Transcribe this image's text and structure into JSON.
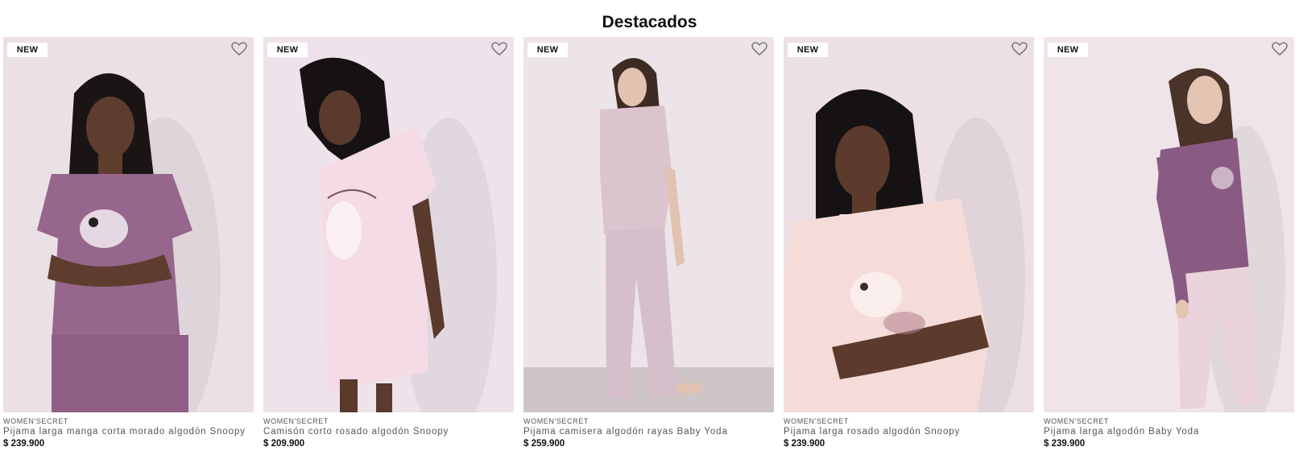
{
  "section": {
    "title": "Destacados"
  },
  "products": [
    {
      "badge": "NEW",
      "brand": "WOMEN'SECRET",
      "name": "Pijama larga manga corta morado algodón Snoopy",
      "price": "$ 239.900",
      "favorite_icon": "heart-outline-icon",
      "colors": {
        "background": "#ebe0e6",
        "top": "#96668c",
        "bottom": "#8e5e84",
        "skin": "#5e3d2e",
        "hair": "#1a1415"
      }
    },
    {
      "badge": "NEW",
      "brand": "WOMEN'SECRET",
      "name": "Camisón corto rosado algodón Snoopy",
      "price": "$ 209.900",
      "favorite_icon": "heart-outline-icon",
      "colors": {
        "background": "#eee3ea",
        "top": "#f4dbe6",
        "bottom": "#f4dbe6",
        "skin": "#5a3a2c",
        "hair": "#161213"
      }
    },
    {
      "badge": "NEW",
      "brand": "WOMEN'SECRET",
      "name": "Pijama camisera algodón rayas Baby Yoda",
      "price": "$ 259.900",
      "favorite_icon": "heart-outline-icon",
      "colors": {
        "background": "#ece4e8",
        "top": "#dcc4cf",
        "bottom": "#d6bfcb",
        "skin": "#e2c2b0",
        "hair": "#3e2b24"
      }
    },
    {
      "badge": "NEW",
      "brand": "WOMEN'SECRET",
      "name": "Pijama larga rosado algodón Snoopy",
      "price": "$ 239.900",
      "favorite_icon": "heart-outline-icon",
      "colors": {
        "background": "#ecdfe5",
        "top": "#f5dcd8",
        "bottom": "#f5dcd8",
        "skin": "#5c3b2c",
        "hair": "#161213"
      }
    },
    {
      "badge": "NEW",
      "brand": "WOMEN'SECRET",
      "name": "Pijama larga algodón Baby Yoda",
      "price": "$ 239.900",
      "favorite_icon": "heart-outline-icon",
      "colors": {
        "background": "#eee4ea",
        "top": "#8a5b82",
        "bottom": "#ead3dd",
        "skin": "#e4c4b2",
        "hair": "#4a3328"
      }
    }
  ]
}
